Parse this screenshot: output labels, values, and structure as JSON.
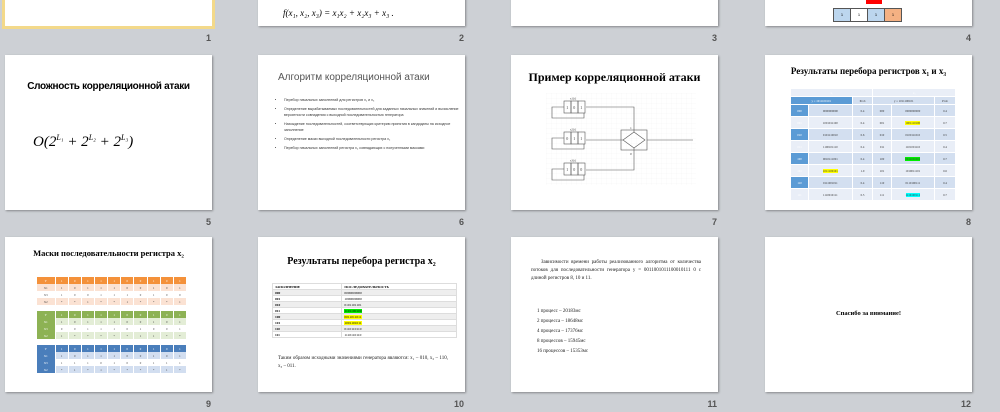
{
  "slide_numbers": [
    "1",
    "2",
    "3",
    "4",
    "5",
    "6",
    "7",
    "8",
    "9",
    "10",
    "11",
    "12"
  ],
  "slide2": {
    "formula": "f(x₁, x₂, x₃) = x₁x₂ + x₂x₃ + x₃ ."
  },
  "slide4": {
    "bits": [
      "1",
      "1",
      "1",
      "1"
    ],
    "colors": [
      "#bcd6ee",
      "#ffffff",
      "#bcd6ee",
      "#f4b183"
    ],
    "marker_color": "#ff0000"
  },
  "slide5": {
    "title": "Сложность корреляционной атаки",
    "formula_base": "O(2",
    "l1": "L₁",
    "plus1": " + 2",
    "l2": "L₂",
    "plus2": " + 2",
    "l3": "L₃",
    "close": ")"
  },
  "slide6": {
    "title": "Алгоритм корреляционной атаки",
    "bullets": [
      "Перебор начальных заполнений для регистров x₁ и x₃",
      "Определение вырабатываемых последовательностей для заданных начальных значений и вычисление вероятности совпадения с выходной последовательностью генератора",
      "Нахождение последовательностей, соответствующих критерию принятия в кандидаты на исходное заполнение",
      "Определение маски выходной последовательности регистра x₂",
      "Перебор начальных заполнений регистра x₂ совпадающих с полученными масками"
    ]
  },
  "slide7": {
    "title": "Пример корреляционной атаки",
    "registers": [
      {
        "label": "x1(t)",
        "bits": [
          "1",
          "0",
          "1"
        ]
      },
      {
        "label": "x2(t)",
        "bits": [
          "0",
          "1",
          "1"
        ]
      },
      {
        "label": "x3(t)",
        "bits": [
          "1",
          "0",
          "0"
        ]
      }
    ],
    "mux_labels": [
      "1",
      "0"
    ]
  },
  "slide8": {
    "title": "Результаты перебора  регистров  x₁ и x₃",
    "headers": [
      "x₁",
      "x₃"
    ],
    "sub": [
      "y = 1011100101",
      "Prob",
      "y = 1011100101",
      "Prob"
    ],
    "rows": [
      [
        "000",
        "0000000000",
        "0.4",
        "000",
        "0000000000",
        "0.4",
        ""
      ],
      [
        "001",
        "1001011100",
        "0.4",
        "001",
        "1001110100",
        "0.7",
        "#ffff00"
      ],
      [
        "010",
        "0101110010",
        "0.6",
        "010",
        "0100111010",
        "0.5",
        ""
      ],
      [
        "011",
        "1100101110",
        "0.4",
        "011",
        "1101001110",
        "0.4",
        ""
      ],
      [
        "100",
        "0010111001",
        "0.4",
        "100",
        "0011101001",
        "0.7",
        "#00ee00"
      ],
      [
        "101",
        "1011100101",
        "1.0",
        "101",
        "1010011101",
        "0.6",
        ""
      ],
      [
        "110",
        "0111001011",
        "0.4",
        "110",
        "0110100111",
        "0.4",
        ""
      ],
      [
        "111",
        "1110010111",
        "0.5",
        "111",
        "1110100111",
        "0.7",
        "#00ffff"
      ]
    ],
    "x1_highlight_row": 5
  },
  "slide9": {
    "title": "Маски  последовательности  регистра  x₂",
    "tables": [
      {
        "color": "#f4913a",
        "light": "#fbe2d3",
        "rows": [
          [
            "Y",
            "1",
            "0",
            "1",
            "1",
            "1",
            "0",
            "0",
            "1",
            "0",
            "1"
          ],
          [
            "X1",
            "1",
            "0",
            "1",
            "1",
            "1",
            "0",
            "0",
            "1",
            "0",
            "1"
          ],
          [
            "X3",
            "1",
            "0",
            "0",
            "1",
            "1",
            "1",
            "0",
            "1",
            "0",
            "0"
          ],
          [
            "X2",
            "*",
            "*",
            "1",
            "*",
            "*",
            "1",
            "*",
            "*",
            "*",
            "1"
          ]
        ]
      },
      {
        "color": "#8db254",
        "light": "#e3edd6",
        "rows": [
          [
            "Y",
            "1",
            "0",
            "1",
            "1",
            "1",
            "0",
            "0",
            "1",
            "0",
            "1"
          ],
          [
            "X1",
            "1",
            "0",
            "1",
            "1",
            "1",
            "0",
            "0",
            "1",
            "0",
            "1"
          ],
          [
            "X3",
            "0",
            "0",
            "1",
            "1",
            "1",
            "0",
            "1",
            "0",
            "0",
            "1"
          ],
          [
            "X2",
            "1",
            "*",
            "*",
            "*",
            "*",
            "*",
            "1",
            "1",
            "*",
            "*"
          ]
        ]
      },
      {
        "color": "#4a7ebb",
        "light": "#d2def0",
        "rows": [
          [
            "Y",
            "1",
            "0",
            "1",
            "1",
            "1",
            "0",
            "0",
            "1",
            "0",
            "1"
          ],
          [
            "X1",
            "1",
            "0",
            "1",
            "1",
            "1",
            "0",
            "0",
            "1",
            "0",
            "1"
          ],
          [
            "X3",
            "1",
            "1",
            "1",
            "0",
            "1",
            "0",
            "0",
            "1",
            "1",
            "1"
          ],
          [
            "X2",
            "*",
            "1",
            "*",
            "1",
            "*",
            "*",
            "*",
            "*",
            "1",
            "*"
          ]
        ]
      }
    ]
  },
  "slide10": {
    "title": "Результаты перебора регистра x₂",
    "headers": [
      "ЗАПОЛНЕНИЕ",
      "ПОСЛЕДОВАТЕЛЬНОСТЬ"
    ],
    "rows": [
      [
        "000",
        "0000000000",
        ""
      ],
      [
        "001",
        "1000000000",
        ""
      ],
      [
        "010",
        "0101101101",
        ""
      ],
      [
        "011",
        "1101100100",
        "#00ee00"
      ],
      [
        "100",
        "0011011011",
        "#ffff00"
      ],
      [
        "101",
        "1001101011",
        "#ffff00"
      ],
      [
        "110",
        "0110110110",
        ""
      ],
      [
        "111",
        "1110110110",
        ""
      ]
    ],
    "note": "Таким образом исходными значениями генератора являются: x₁ – 010, x₂ – 110, x₃ – 011."
  },
  "slide11": {
    "intro": "Зависимости времени работы реализованного алгоритма от количества потоков для последовательности генератора y = 0011001011100010111 0 с длиной регистров 8, 10 и 11.",
    "items": [
      "1 процесс – 20183мс",
      "2 процесса – 18648мс",
      "4 процесса – 17376мс",
      "8 процессов – 15945мс",
      "16 процессов – 15353мс"
    ]
  },
  "slide12": {
    "title": "Спасибо за внимание!"
  }
}
